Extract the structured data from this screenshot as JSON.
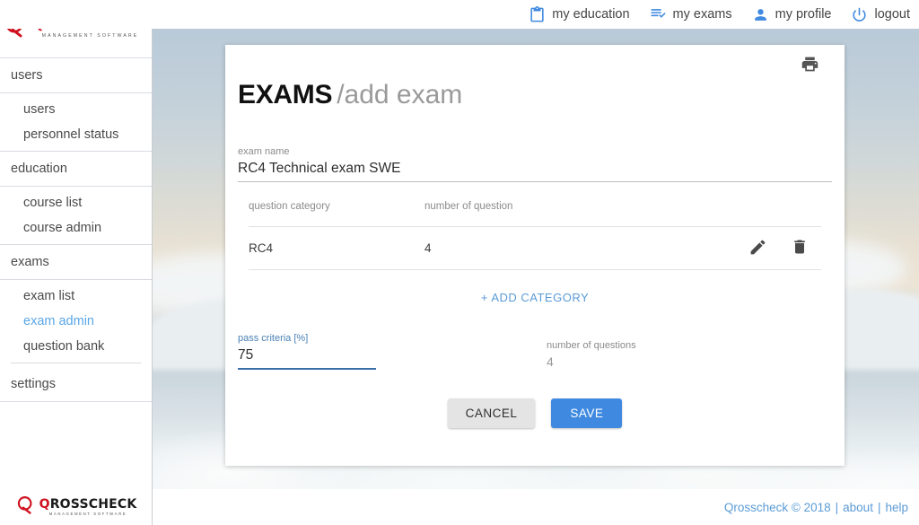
{
  "brand": {
    "logo_q": "Q",
    "logo_name": "ROSSCHECK",
    "logo_tagline": "MANAGEMENT SOFTWARE",
    "accent_red": "#cf111f",
    "accent_blue": "#3f8ae0",
    "link_blue": "#5b9bd5",
    "active_blue": "#5aa7e8"
  },
  "topnav": {
    "items": [
      {
        "label": "my education",
        "icon": "clipboard-icon"
      },
      {
        "label": "my exams",
        "icon": "playlist-check-icon"
      },
      {
        "label": "my profile",
        "icon": "person-icon"
      },
      {
        "label": "logout",
        "icon": "power-icon"
      }
    ]
  },
  "sidebar": {
    "groups": [
      {
        "section": "users",
        "items": [
          {
            "label": "users",
            "active": false
          },
          {
            "label": "personnel status",
            "active": false
          }
        ]
      },
      {
        "section": "education",
        "items": [
          {
            "label": "course list",
            "active": false
          },
          {
            "label": "course admin",
            "active": false
          }
        ]
      },
      {
        "section": "exams",
        "items": [
          {
            "label": "exam list",
            "active": false
          },
          {
            "label": "exam admin",
            "active": true
          },
          {
            "label": "question bank",
            "active": false
          }
        ]
      },
      {
        "section": "settings",
        "items": []
      }
    ]
  },
  "modal": {
    "print_icon": "printer-icon",
    "title_main": "EXAMS",
    "title_sub": "/add exam",
    "exam_name": {
      "label": "exam name",
      "value": "RC4 Technical exam SWE",
      "placeholder": "exam name"
    },
    "table": {
      "headers": {
        "category": "question category",
        "number": "number of question"
      },
      "rows": [
        {
          "category": "RC4",
          "number": "4",
          "edit_icon": "pencil-icon",
          "delete_icon": "trash-icon"
        }
      ],
      "add_label": "+ ADD CATEGORY"
    },
    "pass_criteria": {
      "label": "pass criteria [%]",
      "value": "75",
      "placeholder": "pass criteria [%]"
    },
    "number_of_questions": {
      "label": "number of questions",
      "value": "4"
    },
    "cancel_label": "CANCEL",
    "save_label": "SAVE"
  },
  "footer": {
    "copyright": "Qrosscheck © 2018",
    "sep": "|",
    "about": "about",
    "help": "help"
  }
}
